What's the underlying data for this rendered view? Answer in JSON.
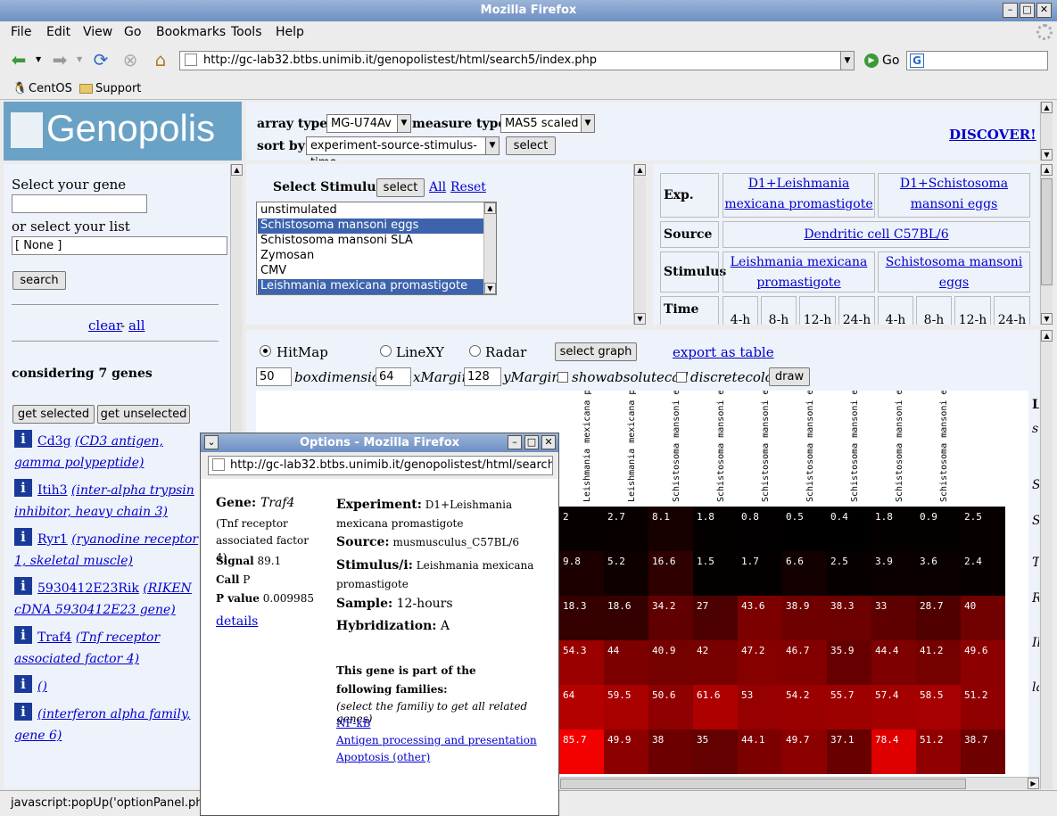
{
  "window": {
    "title": "Mozilla Firefox"
  },
  "menu": [
    "File",
    "Edit",
    "View",
    "Go",
    "Bookmarks",
    "Tools",
    "Help"
  ],
  "nav": {
    "url": "http://gc-lab32.btbs.unimib.it/genopolistest/html/search5/index.php",
    "go_label": "Go"
  },
  "bookmarks": [
    {
      "label": "CentOS",
      "icon": "penguin-icon"
    },
    {
      "label": "Support",
      "icon": "folder-icon"
    }
  ],
  "header": {
    "logo_text": "Genopolis",
    "array_type_label": "array type:",
    "array_type_value": "MG-U74Av",
    "measure_type_label": "measure type:",
    "measure_type_value": "MAS5 scaled",
    "sort_by_label": "sort by:",
    "sort_by_value": "experiment-source-stimulus-time",
    "select_label": "select",
    "discover_label": "DISCOVER!"
  },
  "left": {
    "select_gene_label": "Select your gene",
    "gene_input_value": "",
    "select_list_label": "or select your list",
    "list_value": "[ None ]",
    "search_label": "search",
    "clear_label": "clear",
    "dash": "-",
    "all_label": "all",
    "considering": "considering 7 genes",
    "get_selected": "get selected",
    "get_unselected": "get unselected",
    "genes": [
      {
        "symbol": "Cd3g",
        "desc": "(CD3 antigen, gamma polypeptide)"
      },
      {
        "symbol": "Itih3",
        "desc": "(inter-alpha trypsin inhibitor, heavy chain 3)"
      },
      {
        "symbol": "Ryr1",
        "desc": "(ryanodine receptor 1, skeletal muscle)"
      },
      {
        "symbol": "5930412E23Rik",
        "desc": "(RIKEN cDNA 5930412E23 gene)"
      },
      {
        "symbol": "Traf4",
        "desc": "(Tnf receptor associated factor 4)"
      },
      {
        "symbol": "",
        "desc": "()"
      },
      {
        "symbol": "",
        "desc": "(interferon alpha family, gene 6)"
      }
    ]
  },
  "stimulus": {
    "title": "Select Stimulus/i",
    "select_label": "select",
    "all_label": "All",
    "reset_label": "Reset",
    "options": [
      {
        "label": "unstimulated",
        "selected": false
      },
      {
        "label": "Schistosoma mansoni eggs",
        "selected": true
      },
      {
        "label": "Schistosoma mansoni SLA",
        "selected": false
      },
      {
        "label": "Zymosan",
        "selected": false
      },
      {
        "label": "CMV",
        "selected": false
      },
      {
        "label": "Leishmania mexicana promastigote",
        "selected": true
      }
    ]
  },
  "exptable": {
    "exp_label": "Exp.",
    "exp1": "D1+Leishmania mexicana promastigote",
    "exp2": "D1+Schistosoma mansoni eggs",
    "source_label": "Source",
    "source": "Dendritic cell C57BL/6",
    "stimulus_label": "Stimulus",
    "stim1": "Leishmania mexicana promastigote",
    "stim2": "Schistosoma mansoni eggs",
    "time_label": "Time",
    "times": [
      "4-h",
      "8-h",
      "12-h",
      "24-h",
      "4-h",
      "8-h",
      "12-h",
      "24-h"
    ]
  },
  "graph": {
    "hitmap": "HitMap",
    "linexy": "LineXY",
    "radar": "Radar",
    "select_graph": "select graph",
    "export": "export as table",
    "boxdim_value": "50",
    "boxdim_label": "boxdimension",
    "xmargin_value": "64",
    "xmargin_label": "xMargin",
    "ymargin_value": "128",
    "ymargin_label": "yMargin",
    "showabs_label": "showabsolutecall",
    "discrete_label": "discretecolor",
    "draw_label": "draw",
    "col_labels": [
      "xicana p",
      "xicana p",
      "xicana p",
      "xicana p",
      "xicana p",
      "xicana p",
      "Leishmania mexicana p",
      "Leishmania mexicana p",
      "Schistosoma mansoni e",
      "Schistosoma mansoni e",
      "Schistosoma mansoni e",
      "Schistosoma mansoni e",
      "Schistosoma mansoni e",
      "Schistosoma mansoni e",
      "Schistosoma mansoni e"
    ],
    "right_letters": [
      "L",
      "s",
      "S",
      "S",
      "T",
      "R",
      "Il",
      "la"
    ],
    "rows": [
      [
        "2",
        "2.7",
        "8.1",
        "1.8",
        "0.8",
        "0.5",
        "0.4",
        "1.8",
        "0.9",
        "2.5"
      ],
      [
        "9.8",
        "5.2",
        "16.6",
        "1.5",
        "1.7",
        "6.6",
        "2.5",
        "3.9",
        "3.6",
        "2.4"
      ],
      [
        "18.3",
        "18.6",
        "34.2",
        "27",
        "43.6",
        "38.9",
        "38.3",
        "33",
        "28.7",
        "40"
      ],
      [
        "54.3",
        "44",
        "40.9",
        "42",
        "47.2",
        "46.7",
        "35.9",
        "44.4",
        "41.2",
        "49.6"
      ],
      [
        "64",
        "59.5",
        "50.6",
        "61.6",
        "53",
        "54.2",
        "55.7",
        "57.4",
        "58.5",
        "51.2"
      ],
      [
        "85.7",
        "49.9",
        "38",
        "35",
        "44.1",
        "49.7",
        "37.1",
        "78.4",
        "51.2",
        "38.7"
      ]
    ]
  },
  "popup": {
    "title": "Options - Mozilla Firefox",
    "url": "http://gc-lab32.btbs.unimib.it/genopolistest/html/search5/optic",
    "gene_label": "Gene:",
    "gene": "Traf4",
    "gene_desc": "(Tnf receptor associated factor 4)",
    "signal_label": "Signal",
    "signal": "89.1",
    "call_label": "Call",
    "call": "P",
    "pvalue_label": "P value",
    "pvalue": "0.009985",
    "details": "details",
    "experiment_label": "Experiment:",
    "experiment": "D1+Leishmania mexicana promastigote",
    "source_label": "Source:",
    "source": "musmusculus_C57BL/6",
    "stimulus_label": "Stimulus/i:",
    "stimulus": "Leishmania mexicana promastigote",
    "sample_label": "Sample:",
    "sample": "12-hours",
    "hybrid_label": "Hybridization:",
    "hybrid": "A",
    "families_intro": "This gene is part of the following families:",
    "families_hint": "(select the familiy to get all related genes)",
    "families": [
      "NF-kB",
      "Antigen processing and presentation",
      "Apoptosis (other)"
    ]
  },
  "status": {
    "text": "javascript:popUp('optionPanel.php?P"
  }
}
